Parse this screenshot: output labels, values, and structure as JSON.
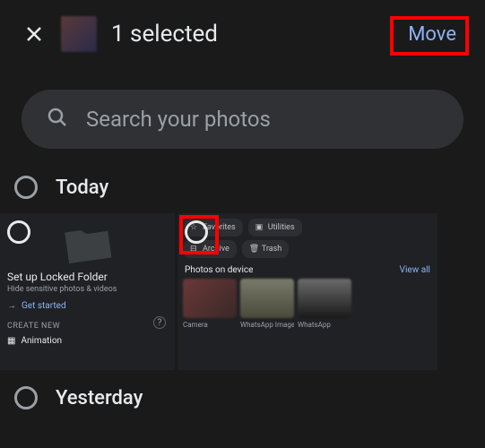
{
  "header": {
    "title": "1 selected",
    "move_label": "Move"
  },
  "search": {
    "placeholder": "Search your photos"
  },
  "sections": {
    "today": "Today",
    "yesterday": "Yesterday"
  },
  "card1": {
    "title": "Set up Locked Folder",
    "subtitle": "Hide sensitive photos & videos",
    "get_started": "Get started",
    "create_new": "CREATE NEW",
    "animation": "Animation"
  },
  "card2": {
    "chips": {
      "favorites": "Favorites",
      "utilities": "Utilities",
      "archive": "Archive",
      "trash": "Trash"
    },
    "photos_on_device": "Photos on device",
    "view_all": "View all",
    "albums": {
      "camera": "Camera",
      "whatsapp_images": "WhatsApp Images",
      "whatsapp": "WhatsApp"
    }
  }
}
